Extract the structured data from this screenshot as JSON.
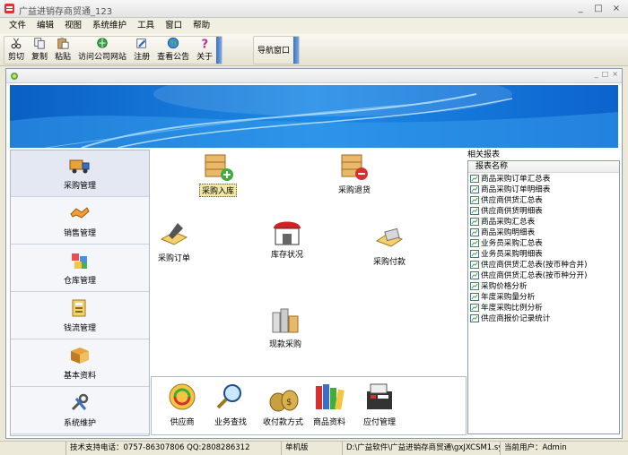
{
  "window": {
    "title": "广益进销存商贸通_123",
    "controls": [
      "_",
      "□",
      "×"
    ]
  },
  "menu": [
    "文件",
    "编辑",
    "视图",
    "系统维护",
    "工具",
    "窗口",
    "帮助"
  ],
  "toolbar": {
    "group1": [
      {
        "label": "剪切",
        "icon": "scissors-icon"
      },
      {
        "label": "复制",
        "icon": "copy-icon"
      },
      {
        "label": "粘贴",
        "icon": "paste-icon"
      },
      {
        "label": "访问公司网站",
        "icon": "web-icon"
      },
      {
        "label": "注册",
        "icon": "register-icon"
      },
      {
        "label": "查看公告",
        "icon": "globe-icon"
      },
      {
        "label": "关于",
        "icon": "help-icon"
      }
    ],
    "group2": [
      {
        "label": "导航窗口"
      }
    ]
  },
  "child_controls": [
    "_",
    "□",
    "×"
  ],
  "nav": [
    {
      "label": "采购管理",
      "icon": "truck-icon"
    },
    {
      "label": "销售管理",
      "icon": "handshake-icon"
    },
    {
      "label": "仓库管理",
      "icon": "boxes-icon"
    },
    {
      "label": "钱流管理",
      "icon": "money-icon"
    },
    {
      "label": "基本资料",
      "icon": "book-icon"
    },
    {
      "label": "系统维护",
      "icon": "tools-icon"
    }
  ],
  "flow": {
    "purchase_in": "采购入库",
    "purchase_return": "采购退货",
    "purchase_order": "采购订单",
    "stock_status": "库存状况",
    "purchase_payment": "采购付款",
    "cash_purchase": "现款采购"
  },
  "quick": [
    "供应商",
    "业务查找",
    "收付款方式",
    "商品资料",
    "应付管理"
  ],
  "reports": {
    "header": "相关报表",
    "column": "报表名称",
    "items": [
      "商品采购订单汇总表",
      "商品采购订单明细表",
      "供应商供货汇总表",
      "供应商供货明细表",
      "商品采购汇总表",
      "商品采购明细表",
      "业务员采购汇总表",
      "业务员采购明细表",
      "供应商供货汇总表(按币种合并)",
      "供应商供货汇总表(按币种分开)",
      "采购价格分析",
      "年度采购量分析",
      "年度采购比例分析",
      "供应商报价记录统计"
    ]
  },
  "status": {
    "support": "技术支持电话：0757-86307806 QQ:2808286312",
    "edition": "单机版",
    "path": "D:\\广益软件\\广益进销存商贸通\\gxJXCSM1.sys",
    "user_label": "当前用户：Admin"
  }
}
